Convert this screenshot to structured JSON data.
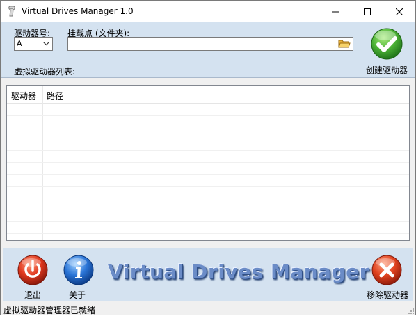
{
  "window": {
    "title": "Virtual Drives Manager 1.0",
    "minimize_label": "Minimize",
    "maximize_label": "Maximize",
    "close_label": "Close"
  },
  "top_panel": {
    "drive_letter_label": "驱动器号:",
    "drive_letter_value": "A",
    "mount_point_label": "挂载点 (文件夹):",
    "mount_point_value": "",
    "list_label": "虚拟驱动器列表:",
    "create_button_label": "创建驱动器"
  },
  "drive_list": {
    "columns": [
      "驱动器",
      "路径"
    ],
    "rows": []
  },
  "bottom_panel": {
    "exit_label": "退出",
    "about_label": "关于",
    "brand_text": "Virtual Drives Manager",
    "remove_label": "移除驱动器"
  },
  "status_bar": {
    "text": "虚拟驱动器管理器已就绪"
  },
  "colors": {
    "panel_bg": "#d4e2f0",
    "create_green": "#3aa43a",
    "exit_red": "#d9301e",
    "about_blue": "#1d63c8",
    "remove_red": "#d93a1e"
  },
  "icons": {
    "app": "usb-drive-icon",
    "browse": "folder-open-icon",
    "create": "green-checkmark-icon",
    "exit": "power-icon",
    "about": "info-icon",
    "remove": "red-x-icon"
  }
}
